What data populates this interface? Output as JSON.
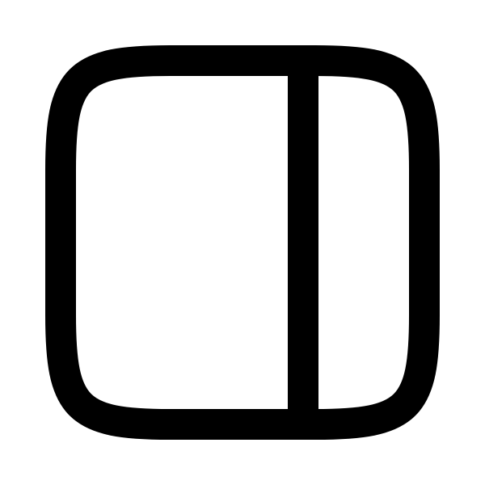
{
  "icon": {
    "name": "sidebar-right-icon",
    "stroke_color": "#000000",
    "background_color": "#ffffff"
  }
}
